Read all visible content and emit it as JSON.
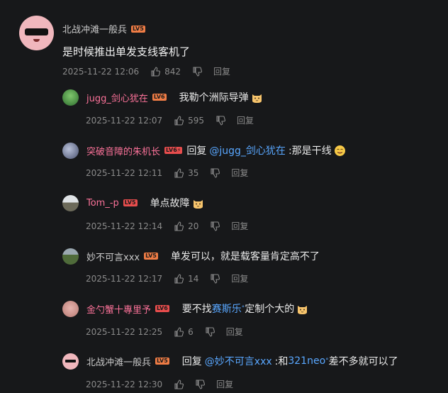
{
  "main_comment": {
    "username": "北战冲滩一般兵",
    "level": "LV5",
    "text": "是时候推出单发支线客机了",
    "time": "2025-11-22 12:06",
    "likes": "842",
    "reply_label": "回复"
  },
  "replies": [
    {
      "username": "jugg_剑心犹在",
      "level": "LV6",
      "prefix": "",
      "mention": "",
      "mention2": "",
      "text": "我勒个洲际导弹",
      "time": "2025-11-22 12:07",
      "likes": "595",
      "reply_label": "回复"
    },
    {
      "username": "突破音障的朱机长",
      "level": "LV6⚡",
      "prefix": "回复",
      "mention": "@jugg_剑心犹在",
      "text": ":那是干线",
      "time": "2025-11-22 12:11",
      "likes": "35",
      "reply_label": "回复"
    },
    {
      "username": "Tom_-p",
      "level": "LV5",
      "text": "单点故障",
      "time": "2025-11-22 12:14",
      "likes": "20",
      "reply_label": "回复"
    },
    {
      "username": "妙不可言xxx",
      "level": "LV5",
      "text": "单发可以，就是载客量肯定高不了",
      "time": "2025-11-22 12:17",
      "likes": "14",
      "reply_label": "回复"
    },
    {
      "username": "金勺蟹十專里予",
      "level": "LV6",
      "text_before": "要不找",
      "mention": "赛斯乐",
      "text_after": "定制个大的",
      "time": "2025-11-22 12:25",
      "likes": "6",
      "reply_label": "回复"
    },
    {
      "username": "北战冲滩一般兵",
      "level": "LV5",
      "prefix": "回复",
      "mention": "@妙不可言xxx",
      "middle": ":和",
      "mention2": "321neo",
      "text": "差不多就可以了",
      "time": "2025-11-22 12:30",
      "likes": "",
      "reply_label": "回复"
    }
  ],
  "colors": {
    "background": "#17181a",
    "mention": "#59a7ff",
    "vip_name": "#fb7299",
    "meta": "#8a8a8a"
  }
}
